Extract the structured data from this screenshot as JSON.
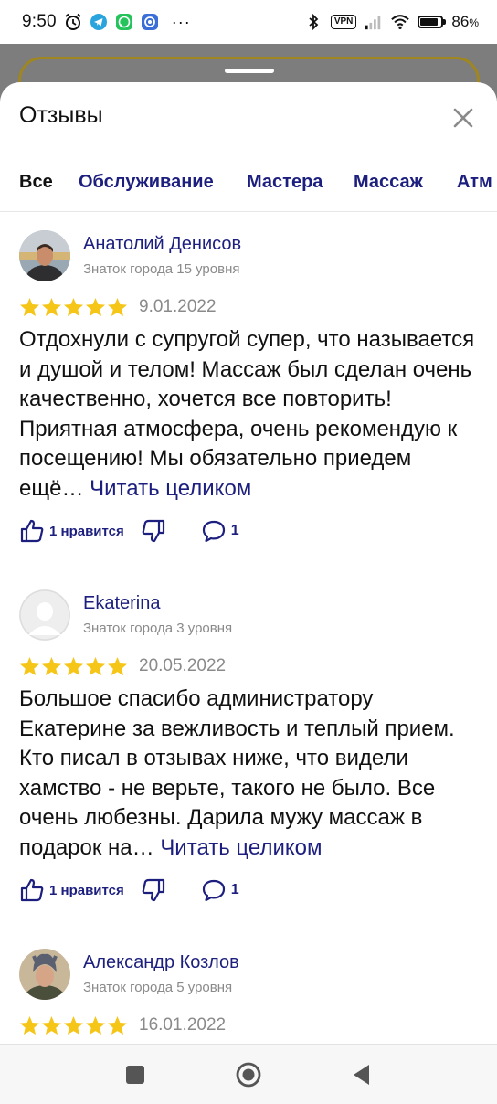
{
  "status_bar": {
    "time": "9:50",
    "vpn": "VPN",
    "battery_percent": "86",
    "battery_unit": "%",
    "battery_level": 0.86,
    "left_icons": [
      "alarm-icon",
      "telegram-icon",
      "whatsapp-icon",
      "app-icon",
      "more-dots"
    ],
    "right_icons": [
      "bluetooth-icon",
      "vpn-badge",
      "signal-icon",
      "wifi-icon",
      "battery-icon"
    ]
  },
  "sheet": {
    "title": "Отзывы",
    "close_icon": "close-icon"
  },
  "tabs": [
    {
      "label": "Все",
      "active": true
    },
    {
      "label": "Обслуживание",
      "active": false
    },
    {
      "label": "Мастера",
      "active": false
    },
    {
      "label": "Массаж",
      "active": false
    },
    {
      "label": "Атм",
      "active": false
    }
  ],
  "reviews": [
    {
      "name": "Анатолий Денисов",
      "level": "Знаток города 15 уровня",
      "rating": 5,
      "date": "9.01.2022",
      "text": "Отдохнули с супругой супер, что называется и душой и телом! Массаж был сделан очень качественно, хочется все повторить! Приятная атмосфера, очень рекомендую к посещению! Мы обязательно приедем ещё…",
      "read_more": "Читать целиком",
      "likes_label": "1 нравится",
      "comments": "1"
    },
    {
      "name": "Ekaterina",
      "level": "Знаток города 3 уровня",
      "rating": 5,
      "date": "20.05.2022",
      "text": "Большое спасибо администратору Екатерине за вежливость и теплый прием. Кто писал в отзывах ниже, что видели хамство - не верьте, такого не было. Все очень любезны. Дарила мужу массаж в подарок на…",
      "read_more": "Читать целиком",
      "likes_label": "1 нравится",
      "comments": "1"
    },
    {
      "name": "Александр Козлов",
      "level": "Знаток города 5 уровня",
      "rating": 5,
      "date": "16.01.2022"
    }
  ],
  "colors": {
    "accent": "#1c1f7e",
    "star": "#f5c518",
    "muted_text": "#8a8a8a",
    "backdrop_border": "#9f8620"
  },
  "nav_bar": {
    "buttons": [
      "recents-square-icon",
      "home-circle-icon",
      "back-triangle-icon"
    ]
  }
}
